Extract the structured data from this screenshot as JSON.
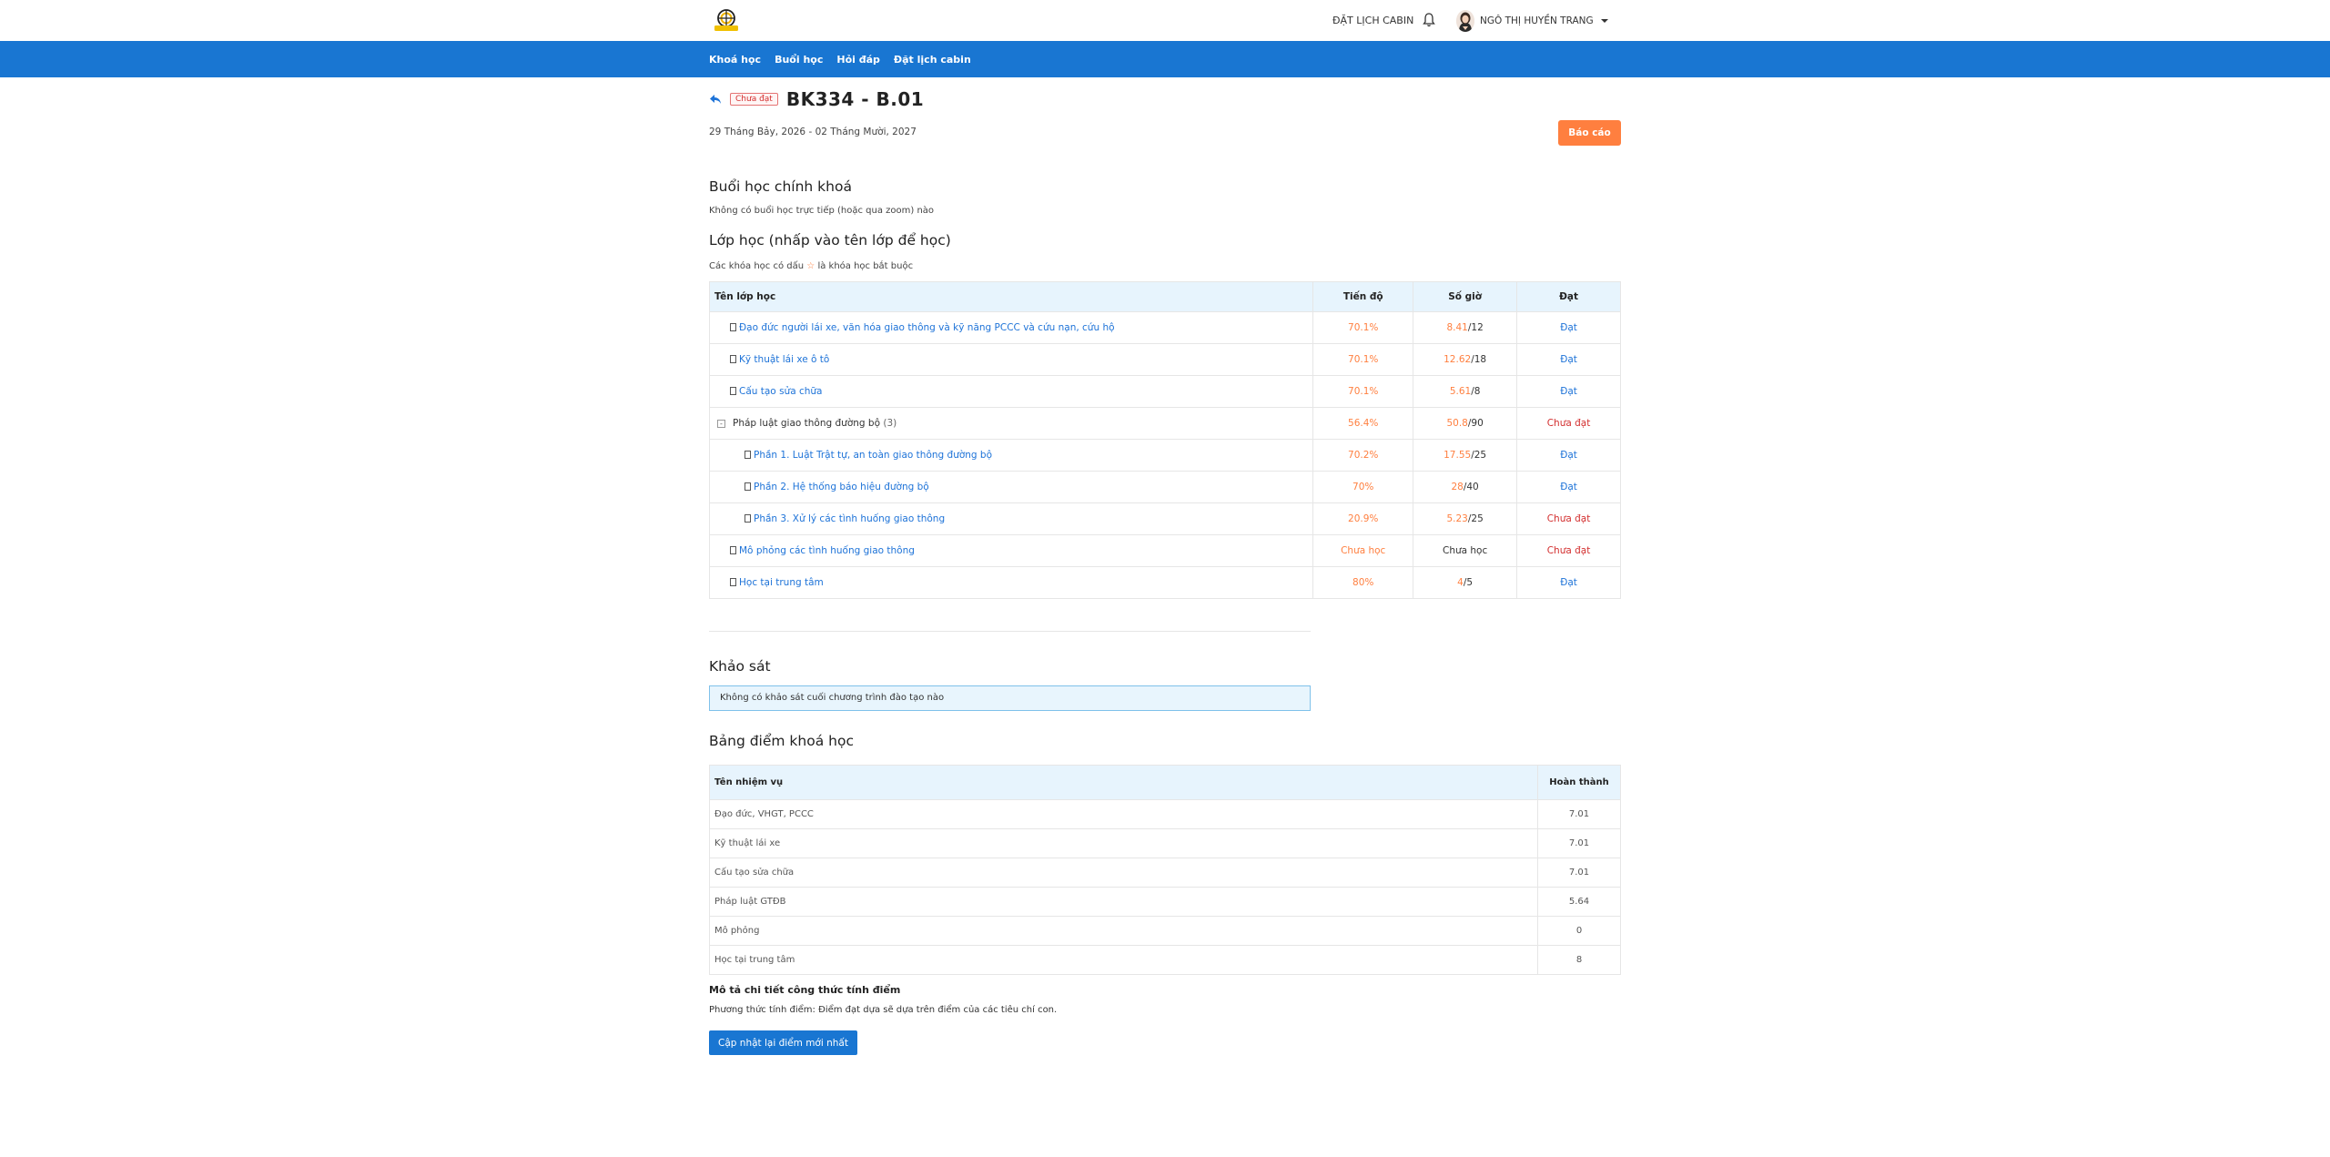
{
  "header": {
    "cabin_link": "ĐẶT LỊCH CABIN",
    "user_name": "NGÔ THỊ HUYỀN TRANG",
    "logo_text": "THÀNH CÔNG"
  },
  "nav": {
    "items": [
      {
        "label": "Khoá học"
      },
      {
        "label": "Buổi học"
      },
      {
        "label": "Hỏi đáp"
      },
      {
        "label": "Đặt lịch cabin"
      }
    ]
  },
  "course": {
    "status_badge": "Chưa đạt",
    "title": "BK334 - B.01",
    "date_range": "29 Tháng Bảy, 2026 - 02 Tháng Mười, 2027",
    "report_button": "Báo cáo"
  },
  "sessions": {
    "heading": "Buổi học chính khoá",
    "empty_text": "Không có buổi học trực tiếp (hoặc qua zoom) nào"
  },
  "classes": {
    "heading": "Lớp học (nhấp vào tên lớp để học)",
    "note_before": "Các khóa học có dấu",
    "note_star": "☆",
    "note_after": "là khóa học bắt buộc",
    "columns": {
      "name": "Tên lớp học",
      "progress": "Tiến độ",
      "hours": "Số giờ",
      "passed": "Đạt"
    },
    "rows": [
      {
        "name": "Đạo đức người lái xe, văn hóa giao thông và kỹ năng PCCC và cứu nạn, cứu hộ",
        "progress": "70.1%",
        "hours_done": "8.41",
        "hours_total": "/12",
        "passed": "Đạt"
      },
      {
        "name": "Kỹ thuật lái xe ô tô",
        "progress": "70.1%",
        "hours_done": "12.62",
        "hours_total": "/18",
        "passed": "Đạt"
      },
      {
        "name": "Cấu tạo sửa chữa",
        "progress": "70.1%",
        "hours_done": "5.61",
        "hours_total": "/8",
        "passed": "Đạt"
      },
      {
        "name": "Pháp luật giao thông đường bộ",
        "count": "(3)",
        "progress": "56.4%",
        "hours_done": "50.8",
        "hours_total": "/90",
        "passed": "Chưa đạt"
      },
      {
        "name": "Phần 1. Luật Trật tự, an toàn giao thông đường bộ",
        "progress": "70.2%",
        "hours_done": "17.55",
        "hours_total": "/25",
        "passed": "Đạt"
      },
      {
        "name": "Phần 2. Hệ thống báo hiệu đường bộ",
        "progress": "70%",
        "hours_done": "28",
        "hours_total": "/40",
        "passed": "Đạt"
      },
      {
        "name": "Phần 3. Xử lý các tình huống giao thông",
        "progress": "20.9%",
        "hours_done": "5.23",
        "hours_total": "/25",
        "passed": "Chưa đạt"
      },
      {
        "name": "Mô phỏng các tình huống giao thông",
        "progress": "Chưa học",
        "hours_text": "Chưa học",
        "passed": "Chưa đạt"
      },
      {
        "name": "Học tại trung tâm",
        "progress": "80%",
        "hours_done": "4",
        "hours_total": "/5",
        "passed": "Đạt"
      }
    ]
  },
  "survey": {
    "heading": "Khảo sát",
    "empty_text": "Không có khảo sát cuối chương trình đào tạo nào"
  },
  "scores": {
    "heading": "Bảng điểm khoá học",
    "columns": {
      "task": "Tên nhiệm vụ",
      "done": "Hoàn thành"
    },
    "rows": [
      {
        "task": "Đạo đức, VHGT, PCCC",
        "score": "7.01"
      },
      {
        "task": "Kỹ thuật lái xe",
        "score": "7.01"
      },
      {
        "task": "Cấu tạo sửa chữa",
        "score": "7.01"
      },
      {
        "task": "Pháp luật GTĐB",
        "score": "5.64"
      },
      {
        "task": "Mô phỏng",
        "score": "0"
      },
      {
        "task": "Học tại trung tâm",
        "score": "8"
      }
    ]
  },
  "formula": {
    "heading": "Mô tả chi tiết công thức tính điểm",
    "text": "Phương thức tính điểm: Điểm đạt dựa sẽ dựa trên điểm của các tiêu chí con.",
    "update_button": "Cập nhật lại điểm mới nhất"
  },
  "colors": {
    "nav_blue": "#1976d2",
    "accent_orange": "#ff7f3f",
    "link_blue": "#1e73d8",
    "fail_red": "#d32f2f",
    "table_header_bg": "#e7f4fd"
  }
}
